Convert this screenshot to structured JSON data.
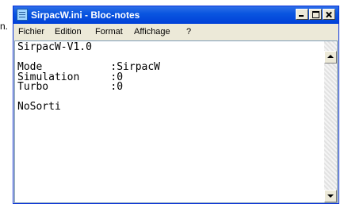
{
  "background": {
    "fragment_text": "n."
  },
  "window": {
    "title": "SirpacW.ini - Bloc-notes",
    "title_bar_color": "#0a56e0",
    "controls": [
      "minimize-icon",
      "maximize-icon",
      "close-icon"
    ]
  },
  "menu": {
    "items": [
      {
        "label": "Fichier"
      },
      {
        "label": "Edition"
      },
      {
        "label": "Format"
      },
      {
        "label": "Affichage"
      },
      {
        "label": "?"
      }
    ]
  },
  "editor": {
    "content": "SirpacW-V1.0\n\nMode           :SirpacW\nSimulation     :0\nTurbo          :0\n\nNoSorti"
  },
  "scrollbar": {
    "icons": [
      "scroll-up-icon",
      "scroll-down-icon"
    ]
  }
}
